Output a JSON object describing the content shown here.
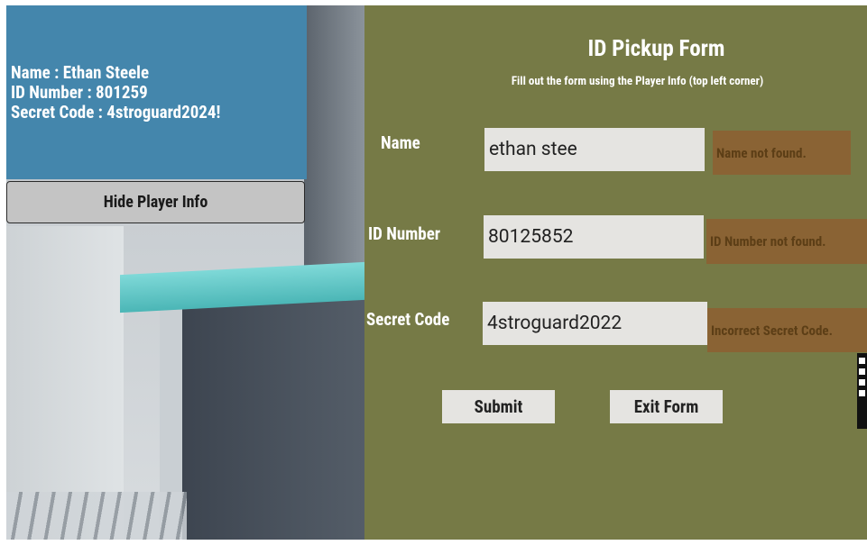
{
  "player_info": {
    "name_line": "Name : Ethan Steele",
    "id_line": "ID Number : 801259",
    "code_line": "Secret Code : 4stroguard2024!",
    "hide_button_label": "Hide Player Info"
  },
  "form": {
    "title": "ID Pickup Form",
    "subtitle": "Fill out the form using the Player Info (top left corner)",
    "fields": [
      {
        "label": "Name",
        "value": "ethan stee",
        "error": "Name not found."
      },
      {
        "label": "ID Number",
        "value": "80125852",
        "error": "ID Number not found."
      },
      {
        "label": "Secret Code",
        "value": "4stroguard2022",
        "error": "Incorrect Secret Code."
      }
    ],
    "submit_label": "Submit",
    "exit_label": "Exit Form"
  },
  "colors": {
    "info_panel": "#4486ac",
    "form_background": "#767a46",
    "error_background": "#8a6334",
    "field_background": "#e5e4e1"
  }
}
